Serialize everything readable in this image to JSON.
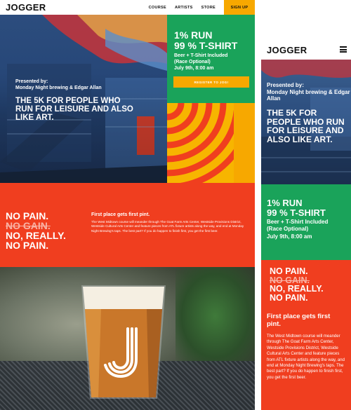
{
  "brand": {
    "logo": "JOGGER"
  },
  "nav": {
    "items": [
      "COURSE",
      "ARTISTS",
      "STORE"
    ],
    "signup": "SIGN UP"
  },
  "hero": {
    "presented_label": "Presented by:",
    "presenters": "Monday Night brewing & Edgar Allan",
    "tagline": "The 5K for people who run for leisure and also like art."
  },
  "event": {
    "title_line1": "1% RUN",
    "title_line2": "99 % T-SHIRT",
    "detail_line1": "Beer + T-Shirt Included",
    "detail_line2": "(Race Optional)",
    "detail_line3": "July 9th, 8:00 am",
    "register_label": "Register to jog!"
  },
  "slogan": {
    "line1": "No pain.",
    "line2": "No gain.",
    "line3": "No, really.",
    "line4": "No pain."
  },
  "info": {
    "heading": "First place gets first pint.",
    "body": "The West Midtown course will meander through The Goat Farm Arts Center, Westside Provisions District, Westside Cultural Arts Center and feature pieces from ATL fixture artists along the way, and end at Monday Night Brewing's taps. The best part? If you do happen to finish first, you get the first beer."
  },
  "mobile": {
    "logo": "JOGGER",
    "hero_presented_label": "Presented by:",
    "hero_presenters": "Monday Night brewing & Edgar Allan",
    "hero_tagline": "The 5K for people who run for leisure and also like art.",
    "event_title_line1": "1% RUN",
    "event_title_line2": "99 % T-SHIRT",
    "event_detail_line1": "Beer + T-Shirt Included",
    "event_detail_line2": "(Race Optional)",
    "event_detail_line3": "July 9th, 8:00 am",
    "slogan_line1": "No pain.",
    "slogan_line2": "No gain.",
    "slogan_line3": "No, really.",
    "slogan_line4": "No pain.",
    "info_heading": "First place gets first pint.",
    "info_body": "The West Midtown course will meander through The Goat Farm Arts Center, Westside Provisions District, Westside Cultural Arts Center and feature pieces from ATL fixture artists along the way, and end at Monday Night Brewing's taps. The best part? If you do happen to finish first, you get the first beer."
  },
  "colors": {
    "accent_yellow": "#f7a800",
    "green": "#1aa35a",
    "red": "#f03e1f",
    "blue": "#2c4d7e"
  },
  "icons": {
    "menu": "hamburger-menu-icon",
    "glass_logo": "j-logo-icon"
  }
}
